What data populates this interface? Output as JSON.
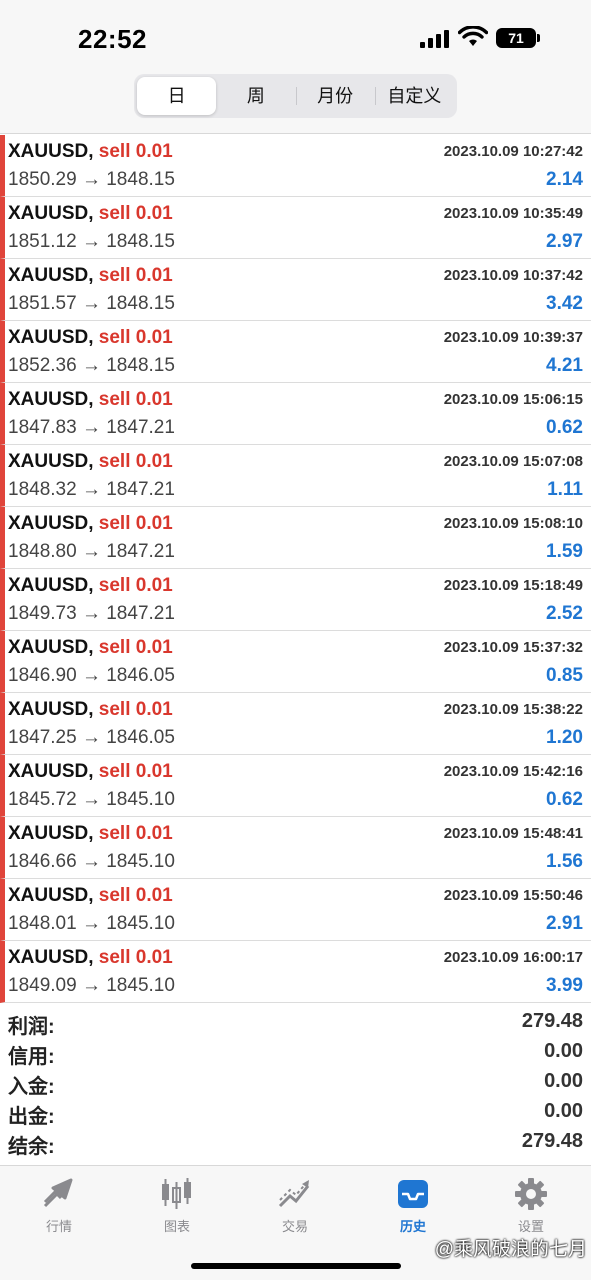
{
  "status": {
    "time": "22:52",
    "battery": "71"
  },
  "tabs": [
    {
      "label": "日",
      "active": true
    },
    {
      "label": "周",
      "active": false
    },
    {
      "label": "月份",
      "active": false
    },
    {
      "label": "自定义",
      "active": false
    }
  ],
  "trades": [
    {
      "symbol": "XAUUSD,",
      "side": "sell 0.01",
      "time": "2023.10.09 10:27:42",
      "prices": "1850.29 → 1848.15",
      "profit": "2.14"
    },
    {
      "symbol": "XAUUSD,",
      "side": "sell 0.01",
      "time": "2023.10.09 10:35:49",
      "prices": "1851.12 → 1848.15",
      "profit": "2.97"
    },
    {
      "symbol": "XAUUSD,",
      "side": "sell 0.01",
      "time": "2023.10.09 10:37:42",
      "prices": "1851.57 → 1848.15",
      "profit": "3.42"
    },
    {
      "symbol": "XAUUSD,",
      "side": "sell 0.01",
      "time": "2023.10.09 10:39:37",
      "prices": "1852.36 → 1848.15",
      "profit": "4.21"
    },
    {
      "symbol": "XAUUSD,",
      "side": "sell 0.01",
      "time": "2023.10.09 15:06:15",
      "prices": "1847.83 → 1847.21",
      "profit": "0.62"
    },
    {
      "symbol": "XAUUSD,",
      "side": "sell 0.01",
      "time": "2023.10.09 15:07:08",
      "prices": "1848.32 → 1847.21",
      "profit": "1.11"
    },
    {
      "symbol": "XAUUSD,",
      "side": "sell 0.01",
      "time": "2023.10.09 15:08:10",
      "prices": "1848.80 → 1847.21",
      "profit": "1.59"
    },
    {
      "symbol": "XAUUSD,",
      "side": "sell 0.01",
      "time": "2023.10.09 15:18:49",
      "prices": "1849.73 → 1847.21",
      "profit": "2.52"
    },
    {
      "symbol": "XAUUSD,",
      "side": "sell 0.01",
      "time": "2023.10.09 15:37:32",
      "prices": "1846.90 → 1846.05",
      "profit": "0.85"
    },
    {
      "symbol": "XAUUSD,",
      "side": "sell 0.01",
      "time": "2023.10.09 15:38:22",
      "prices": "1847.25 → 1846.05",
      "profit": "1.20"
    },
    {
      "symbol": "XAUUSD,",
      "side": "sell 0.01",
      "time": "2023.10.09 15:42:16",
      "prices": "1845.72 → 1845.10",
      "profit": "0.62"
    },
    {
      "symbol": "XAUUSD,",
      "side": "sell 0.01",
      "time": "2023.10.09 15:48:41",
      "prices": "1846.66 → 1845.10",
      "profit": "1.56"
    },
    {
      "symbol": "XAUUSD,",
      "side": "sell 0.01",
      "time": "2023.10.09 15:50:46",
      "prices": "1848.01 → 1845.10",
      "profit": "2.91"
    },
    {
      "symbol": "XAUUSD,",
      "side": "sell 0.01",
      "time": "2023.10.09 16:00:17",
      "prices": "1849.09 → 1845.10",
      "profit": "3.99"
    }
  ],
  "summary": [
    {
      "label": "利润:",
      "value": "279.48"
    },
    {
      "label": "信用:",
      "value": "0.00"
    },
    {
      "label": "入金:",
      "value": "0.00"
    },
    {
      "label": "出金:",
      "value": "0.00"
    },
    {
      "label": "结余:",
      "value": "279.48"
    }
  ],
  "tabbar": [
    {
      "label": "行情",
      "icon": "quotes-icon",
      "active": false
    },
    {
      "label": "图表",
      "icon": "chart-icon",
      "active": false
    },
    {
      "label": "交易",
      "icon": "trade-icon",
      "active": false
    },
    {
      "label": "历史",
      "icon": "history-icon",
      "active": true
    },
    {
      "label": "设置",
      "icon": "settings-icon",
      "active": false
    }
  ],
  "watermark": "@乘风破浪的七月",
  "colors": {
    "sell": "#d9372d",
    "profit": "#1f76d2",
    "accent": "#1f76d2",
    "row_marker": "#e0453b"
  }
}
